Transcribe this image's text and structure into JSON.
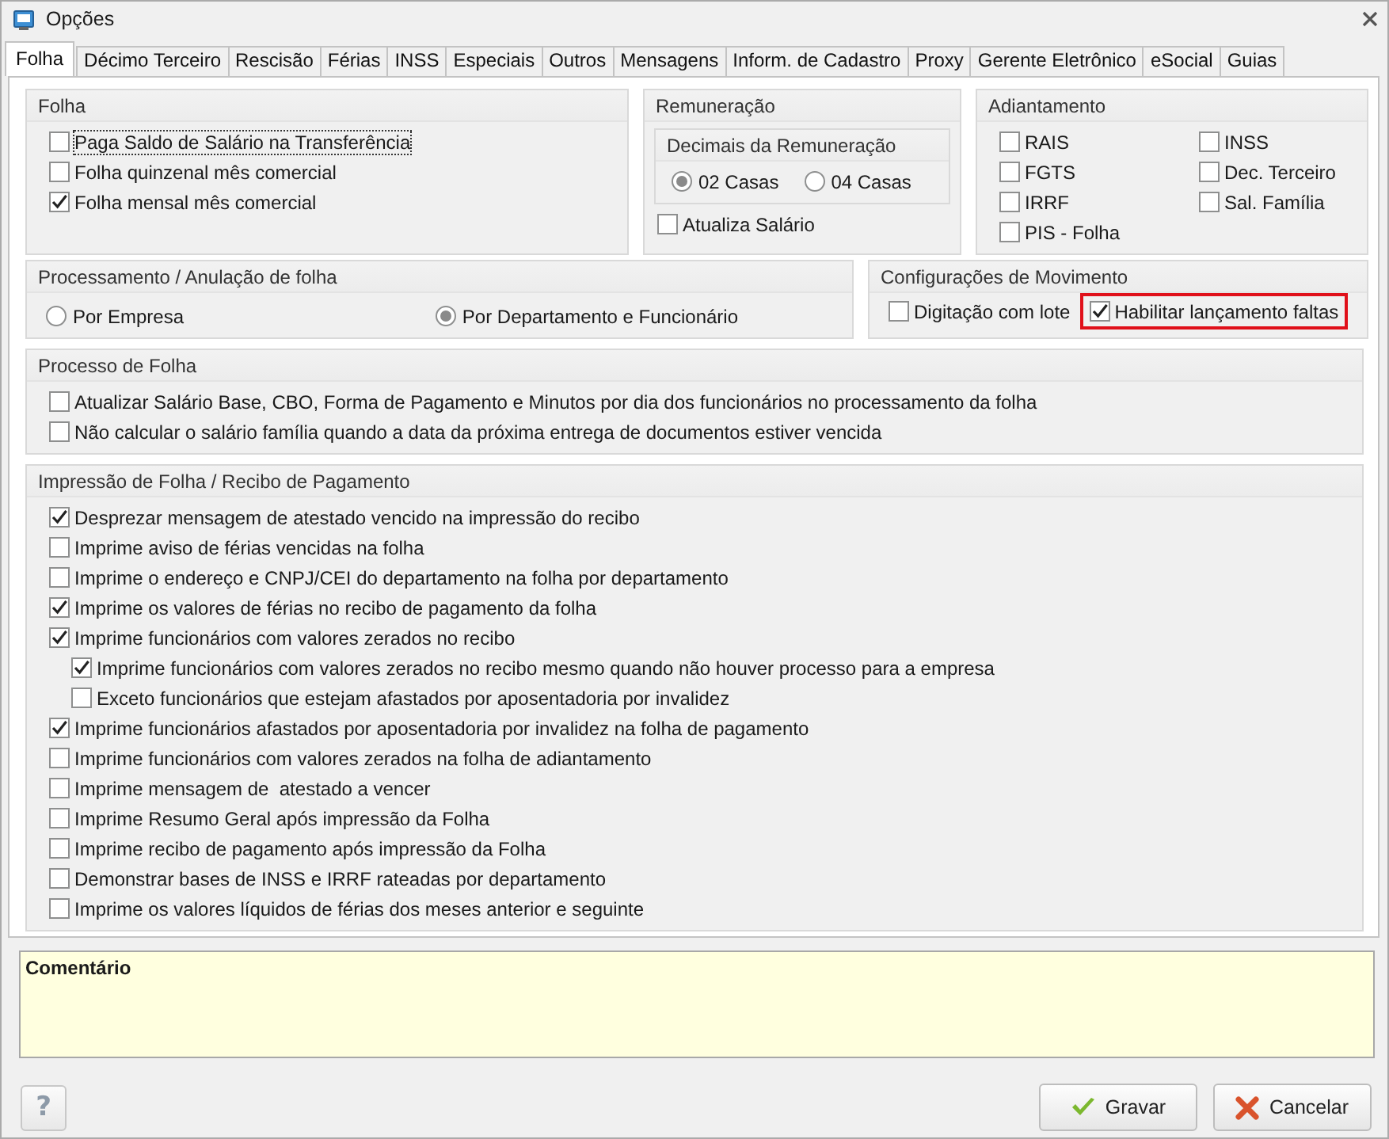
{
  "window": {
    "title": "Opções"
  },
  "tabs": [
    {
      "label": "Folha",
      "selected": true
    },
    {
      "label": "Décimo Terceiro",
      "selected": false
    },
    {
      "label": "Rescisão",
      "selected": false
    },
    {
      "label": "Férias",
      "selected": false
    },
    {
      "label": "INSS",
      "selected": false
    },
    {
      "label": "Especiais",
      "selected": false
    },
    {
      "label": "Outros",
      "selected": false
    },
    {
      "label": "Mensagens",
      "selected": false
    },
    {
      "label": "Inform. de Cadastro",
      "selected": false
    },
    {
      "label": "Proxy",
      "selected": false
    },
    {
      "label": "Gerente Eletrônico",
      "selected": false
    },
    {
      "label": "eSocial",
      "selected": false
    },
    {
      "label": "Guias",
      "selected": false
    }
  ],
  "folha": {
    "title": "Folha",
    "options": [
      {
        "label": "Paga Saldo de Salário na Transferência",
        "checked": false,
        "focused": true
      },
      {
        "label": "Folha quinzenal mês comercial",
        "checked": false,
        "focused": false
      },
      {
        "label": "Folha mensal mês comercial",
        "checked": true,
        "focused": false
      }
    ]
  },
  "remuneracao": {
    "title": "Remuneração",
    "decimais": {
      "title": "Decimais da Remuneração",
      "options": [
        {
          "label": "02 Casas",
          "selected": true
        },
        {
          "label": "04 Casas",
          "selected": false
        }
      ]
    },
    "options": [
      {
        "label": "Atualiza Salário",
        "checked": false
      }
    ]
  },
  "adiantamento": {
    "title": "Adiantamento",
    "options": [
      {
        "label": "RAIS",
        "checked": false
      },
      {
        "label": "INSS",
        "checked": false
      },
      {
        "label": "FGTS",
        "checked": false
      },
      {
        "label": "Dec. Terceiro",
        "checked": false
      },
      {
        "label": "IRRF",
        "checked": false
      },
      {
        "label": "Sal. Família",
        "checked": false
      },
      {
        "label": "PIS - Folha",
        "checked": false
      }
    ]
  },
  "processamento": {
    "title": "Processamento / Anulação de folha",
    "options": [
      {
        "label": "Por Empresa",
        "selected": false
      },
      {
        "label": "Por Departamento e Funcionário",
        "selected": true
      }
    ]
  },
  "movimento": {
    "title": "Configurações de Movimento",
    "options": [
      {
        "label": "Digitação com lote",
        "checked": false
      },
      {
        "label": "Habilitar lançamento faltas",
        "checked": true,
        "highlighted": true
      }
    ]
  },
  "processo": {
    "title": "Processo de Folha",
    "options": [
      {
        "label": "Atualizar Salário Base, CBO, Forma de Pagamento e Minutos por dia dos funcionários no processamento da folha",
        "checked": false
      },
      {
        "label": "Não calcular o salário família quando a data da próxima entrega de documentos estiver vencida",
        "checked": false
      }
    ]
  },
  "impressao": {
    "title": "Impressão de Folha / Recibo de Pagamento",
    "options": [
      {
        "label": "Desprezar mensagem de atestado vencido na impressão do recibo",
        "checked": true
      },
      {
        "label": "Imprime aviso de férias vencidas na folha",
        "checked": false
      },
      {
        "label": "Imprime o endereço e CNPJ/CEI do departamento na folha por departamento",
        "checked": false
      },
      {
        "label": "Imprime os valores de férias no recibo de pagamento da folha",
        "checked": true
      },
      {
        "label": "Imprime funcionários com valores zerados no recibo",
        "checked": true,
        "children": [
          {
            "label": "Imprime funcionários com valores zerados no recibo mesmo quando não houver processo para a empresa",
            "checked": true
          },
          {
            "label": "Exceto funcionários que estejam afastados por aposentadoria por invalidez",
            "checked": false
          }
        ]
      },
      {
        "label": "Imprime funcionários afastados por aposentadoria por invalidez na folha de pagamento",
        "checked": true
      },
      {
        "label": "Imprime funcionários com valores zerados na folha de adiantamento",
        "checked": false
      },
      {
        "label": "Imprime mensagem de  atestado a vencer",
        "checked": false
      },
      {
        "label": "Imprime Resumo Geral após impressão da Folha",
        "checked": false
      },
      {
        "label": "Imprime recibo de pagamento após impressão da Folha",
        "checked": false
      },
      {
        "label": "Demonstrar bases de INSS e IRRF rateadas por departamento",
        "checked": false
      },
      {
        "label": "Imprime os valores líquidos de férias dos meses anterior e seguinte",
        "checked": false
      }
    ]
  },
  "comment": {
    "label": "Comentário"
  },
  "help_button": {
    "label": "?"
  },
  "buttons": [
    {
      "label": "Gravar",
      "kind": "save"
    },
    {
      "label": "Cancelar",
      "kind": "cancel"
    }
  ]
}
